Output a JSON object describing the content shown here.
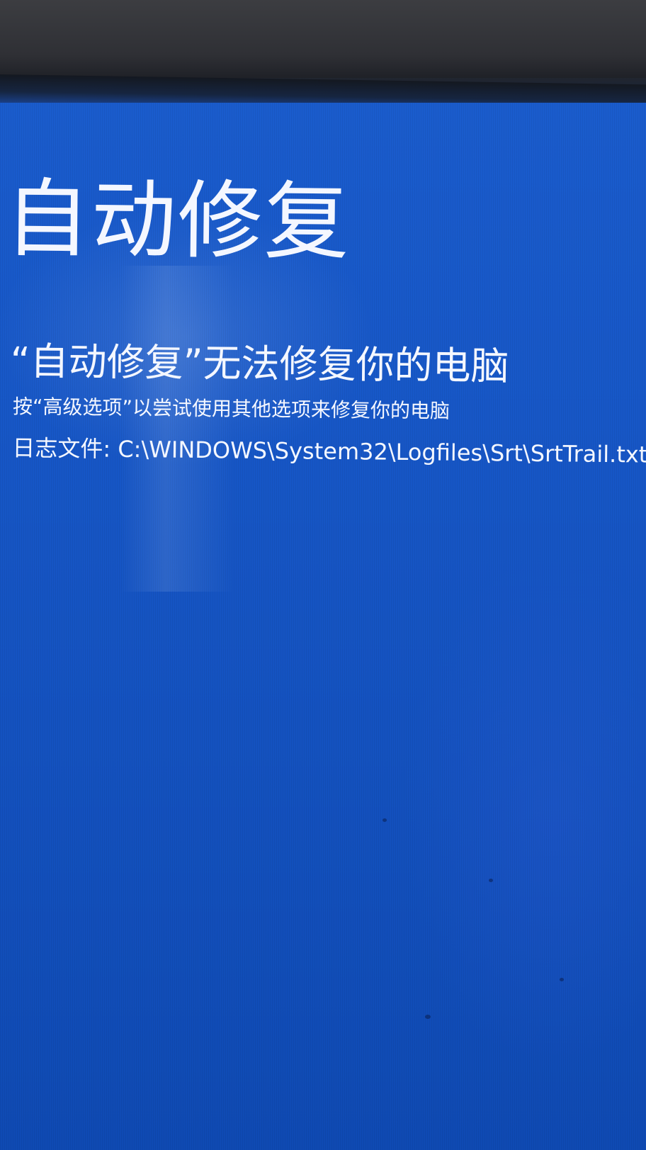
{
  "screen": {
    "title": "自动修复",
    "message": "“自动修复”无法修复你的电脑",
    "hint": "按“高级选项”以尝试使用其他选项来修复你的电脑",
    "logfile": "日志文件: C:\\WINDOWS\\System32\\Logfiles\\Srt\\SrtTrail.txt"
  },
  "colors": {
    "background": "#1757c7",
    "text": "#f4f7ff",
    "bezel": "#2f3035"
  }
}
